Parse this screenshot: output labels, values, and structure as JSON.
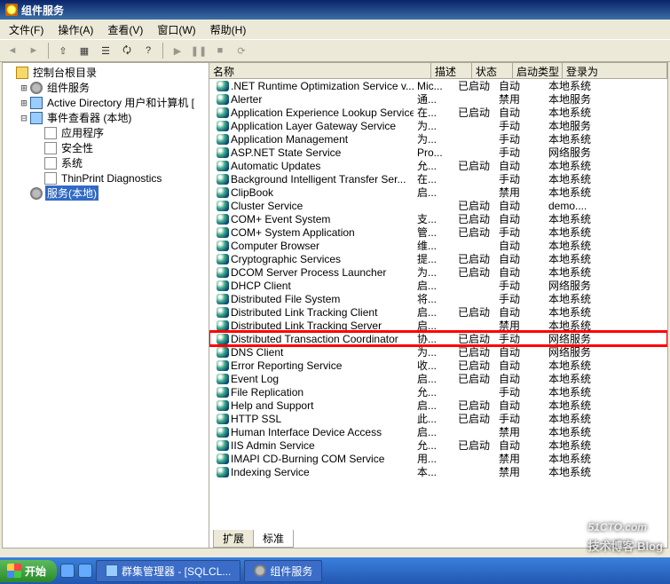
{
  "window": {
    "title": "组件服务"
  },
  "menu": {
    "file": "文件(F)",
    "action": "操作(A)",
    "view": "查看(V)",
    "window": "窗口(W)",
    "help": "帮助(H)"
  },
  "tree": {
    "root": "控制台根目录",
    "items": [
      {
        "label": "组件服务",
        "exp": "+",
        "ico": "gear",
        "indent": 1
      },
      {
        "label": "Active Directory 用户和计算机 [",
        "exp": "+",
        "ico": "computer",
        "indent": 1
      },
      {
        "label": "事件查看器 (本地)",
        "exp": "-",
        "ico": "computer",
        "indent": 1
      },
      {
        "label": "应用程序",
        "exp": "",
        "ico": "doc",
        "indent": 2
      },
      {
        "label": "安全性",
        "exp": "",
        "ico": "doc",
        "indent": 2
      },
      {
        "label": "系统",
        "exp": "",
        "ico": "doc",
        "indent": 2
      },
      {
        "label": "ThinPrint Diagnostics",
        "exp": "",
        "ico": "doc",
        "indent": 2
      },
      {
        "label": "服务(本地)",
        "exp": "",
        "ico": "gear",
        "indent": 1,
        "selected": true
      }
    ]
  },
  "columns": {
    "name": "名称",
    "desc": "描述",
    "status": "状态",
    "startup": "启动类型",
    "logon": "登录为"
  },
  "services": [
    {
      "n": ".NET Runtime Optimization Service v...",
      "d": "Mic...",
      "s": "已启动",
      "t": "自动",
      "l": "本地系统"
    },
    {
      "n": "Alerter",
      "d": "通...",
      "s": "",
      "t": "禁用",
      "l": "本地服务"
    },
    {
      "n": "Application Experience Lookup Service",
      "d": "在...",
      "s": "已启动",
      "t": "自动",
      "l": "本地系统"
    },
    {
      "n": "Application Layer Gateway Service",
      "d": "为...",
      "s": "",
      "t": "手动",
      "l": "本地服务"
    },
    {
      "n": "Application Management",
      "d": "为...",
      "s": "",
      "t": "手动",
      "l": "本地系统"
    },
    {
      "n": "ASP.NET State Service",
      "d": "Pro...",
      "s": "",
      "t": "手动",
      "l": "网络服务"
    },
    {
      "n": "Automatic Updates",
      "d": "允...",
      "s": "已启动",
      "t": "自动",
      "l": "本地系统"
    },
    {
      "n": "Background Intelligent Transfer Ser...",
      "d": "在...",
      "s": "",
      "t": "手动",
      "l": "本地系统"
    },
    {
      "n": "ClipBook",
      "d": "启...",
      "s": "",
      "t": "禁用",
      "l": "本地系统"
    },
    {
      "n": "Cluster Service",
      "d": "",
      "s": "已启动",
      "t": "自动",
      "l": "demo...."
    },
    {
      "n": "COM+ Event System",
      "d": "支...",
      "s": "已启动",
      "t": "自动",
      "l": "本地系统"
    },
    {
      "n": "COM+ System Application",
      "d": "管...",
      "s": "已启动",
      "t": "手动",
      "l": "本地系统"
    },
    {
      "n": "Computer Browser",
      "d": "维...",
      "s": "",
      "t": "自动",
      "l": "本地系统"
    },
    {
      "n": "Cryptographic Services",
      "d": "提...",
      "s": "已启动",
      "t": "自动",
      "l": "本地系统"
    },
    {
      "n": "DCOM Server Process Launcher",
      "d": "为...",
      "s": "已启动",
      "t": "自动",
      "l": "本地系统"
    },
    {
      "n": "DHCP Client",
      "d": "启...",
      "s": "",
      "t": "手动",
      "l": "网络服务"
    },
    {
      "n": "Distributed File System",
      "d": "将...",
      "s": "",
      "t": "手动",
      "l": "本地系统"
    },
    {
      "n": "Distributed Link Tracking Client",
      "d": "启...",
      "s": "已启动",
      "t": "自动",
      "l": "本地系统"
    },
    {
      "n": "Distributed Link Tracking Server",
      "d": "启...",
      "s": "",
      "t": "禁用",
      "l": "本地系统"
    },
    {
      "n": "Distributed Transaction Coordinator",
      "d": "协...",
      "s": "已启动",
      "t": "手动",
      "l": "网络服务",
      "hl": true
    },
    {
      "n": "DNS Client",
      "d": "为...",
      "s": "已启动",
      "t": "自动",
      "l": "网络服务"
    },
    {
      "n": "Error Reporting Service",
      "d": "收...",
      "s": "已启动",
      "t": "自动",
      "l": "本地系统"
    },
    {
      "n": "Event Log",
      "d": "启...",
      "s": "已启动",
      "t": "自动",
      "l": "本地系统"
    },
    {
      "n": "File Replication",
      "d": "允...",
      "s": "",
      "t": "手动",
      "l": "本地系统"
    },
    {
      "n": "Help and Support",
      "d": "启...",
      "s": "已启动",
      "t": "自动",
      "l": "本地系统"
    },
    {
      "n": "HTTP SSL",
      "d": "此...",
      "s": "已启动",
      "t": "手动",
      "l": "本地系统"
    },
    {
      "n": "Human Interface Device Access",
      "d": "启...",
      "s": "",
      "t": "禁用",
      "l": "本地系统"
    },
    {
      "n": "IIS Admin Service",
      "d": "允...",
      "s": "已启动",
      "t": "自动",
      "l": "本地系统"
    },
    {
      "n": "IMAPI CD-Burning COM Service",
      "d": "用...",
      "s": "",
      "t": "禁用",
      "l": "本地系统"
    },
    {
      "n": "Indexing Service",
      "d": "本...",
      "s": "",
      "t": "禁用",
      "l": "本地系统"
    }
  ],
  "tabs": {
    "extended": "扩展",
    "standard": "标准"
  },
  "taskbar": {
    "start": "开始",
    "t1": "群集管理器 - [SQLCL...",
    "t2": "组件服务"
  },
  "watermark": {
    "big": "51CTO.com",
    "small": "技术博客  Blog"
  }
}
